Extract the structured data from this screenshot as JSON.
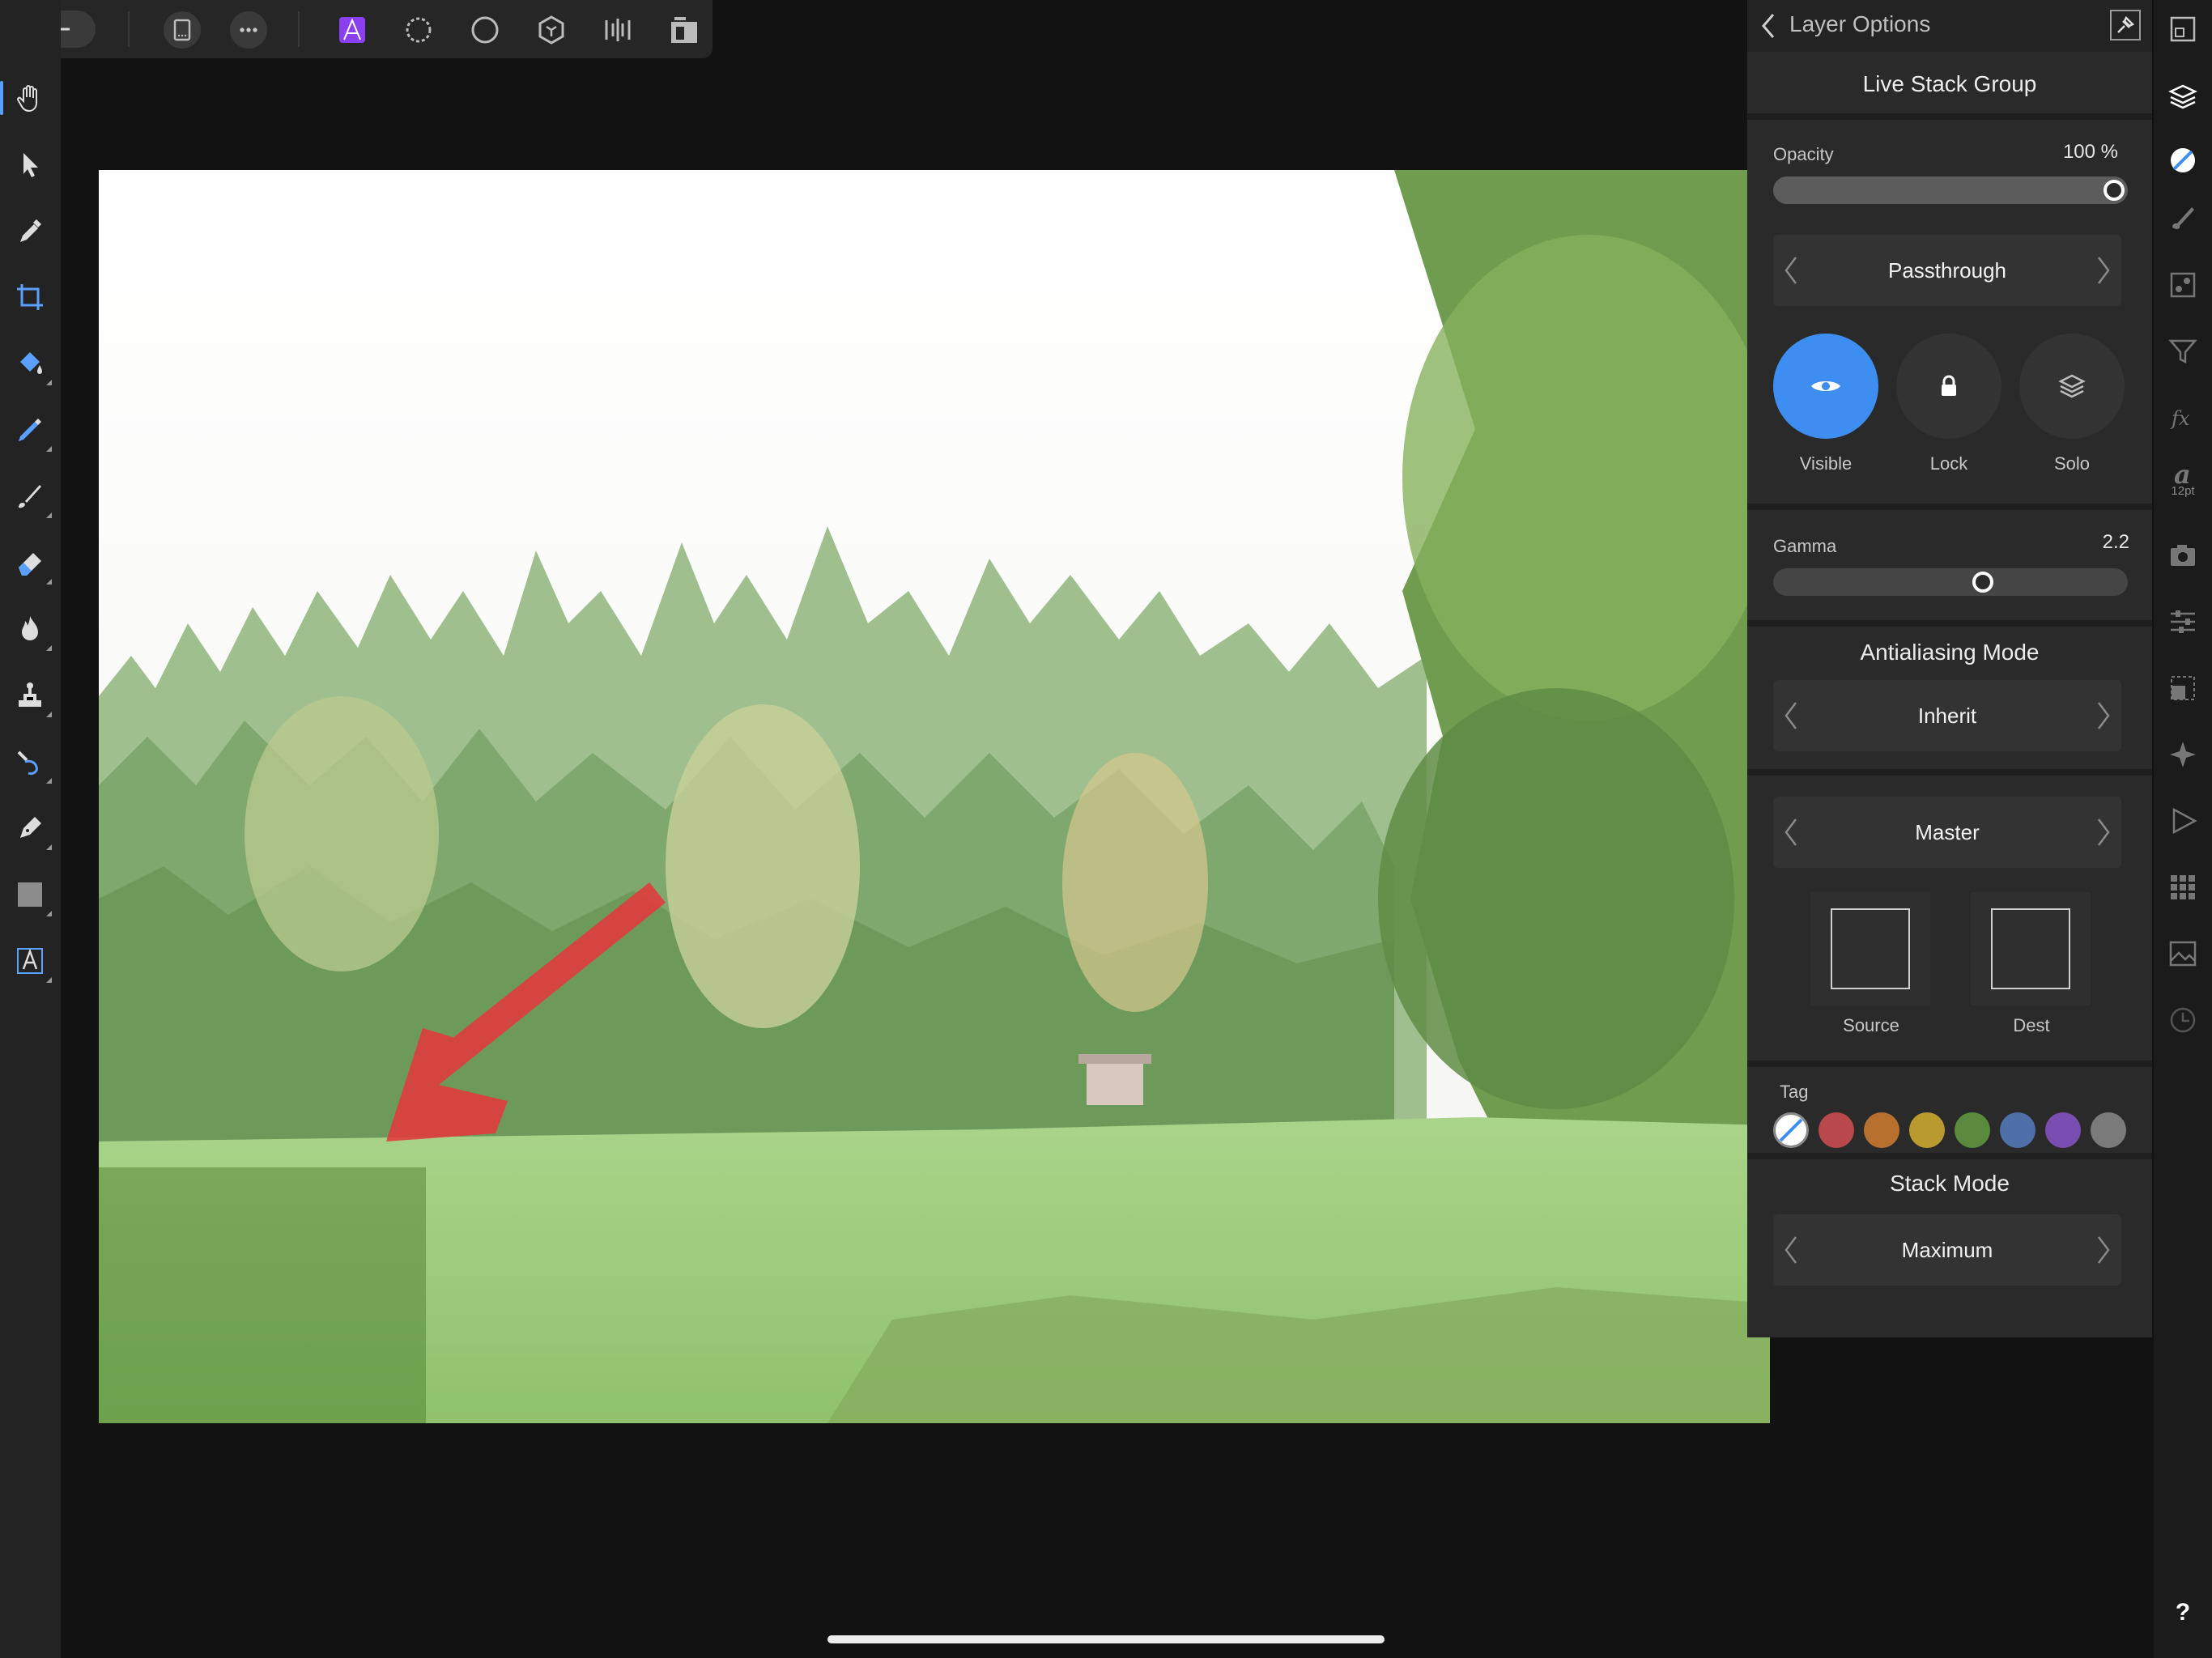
{
  "panel": {
    "title": "Layer Options",
    "group_name": "Live Stack Group",
    "opacity": {
      "label": "Opacity",
      "value_text": "100 %",
      "value": 1.0
    },
    "blend_mode": "Passthrough",
    "toggles": [
      {
        "label": "Visible",
        "on": true
      },
      {
        "label": "Lock",
        "on": false
      },
      {
        "label": "Solo",
        "on": false
      }
    ],
    "gamma": {
      "label": "Gamma",
      "value_text": "2.2",
      "fraction": 0.6
    },
    "antialiasing": {
      "title": "Antialiasing Mode",
      "value": "Inherit"
    },
    "blend_ranges": {
      "value": "Master",
      "source_label": "Source",
      "dest_label": "Dest"
    },
    "tag": {
      "label": "Tag",
      "colors": [
        "none",
        "#b8484a",
        "#b8702e",
        "#b89a2e",
        "#5a8a3e",
        "#4e6fa8",
        "#7a4eb0",
        "#7a7a7a"
      ]
    },
    "stack_mode": {
      "title": "Stack Mode",
      "value": "Maximum"
    }
  },
  "right_bar": {
    "font_size_label": "12pt",
    "help_label": "?"
  },
  "colors": {
    "accent": "#3d8ef0",
    "panel_bg": "#2a2a2a",
    "app_bg": "#121212",
    "toolbar_bg": "#232323",
    "active_persona": "#8a3ff0"
  },
  "icons": {
    "left_tools": [
      "hand-icon",
      "move-icon",
      "color-picker-icon",
      "crop-icon",
      "flood-fill-icon",
      "selection-brush-icon",
      "paint-brush-icon",
      "erase-brush-icon",
      "burn-brush-icon",
      "clone-brush-icon",
      "smudge-brush-icon",
      "pen-icon",
      "rectangle-icon",
      "text-icon"
    ],
    "top_bar": [
      "back-arrow-icon",
      "document-icon",
      "more-icon",
      "photo-persona-icon",
      "liquify-persona-icon",
      "develop-persona-icon",
      "tone-mapping-persona-icon",
      "export-persona-icon",
      "layout-icon"
    ]
  }
}
